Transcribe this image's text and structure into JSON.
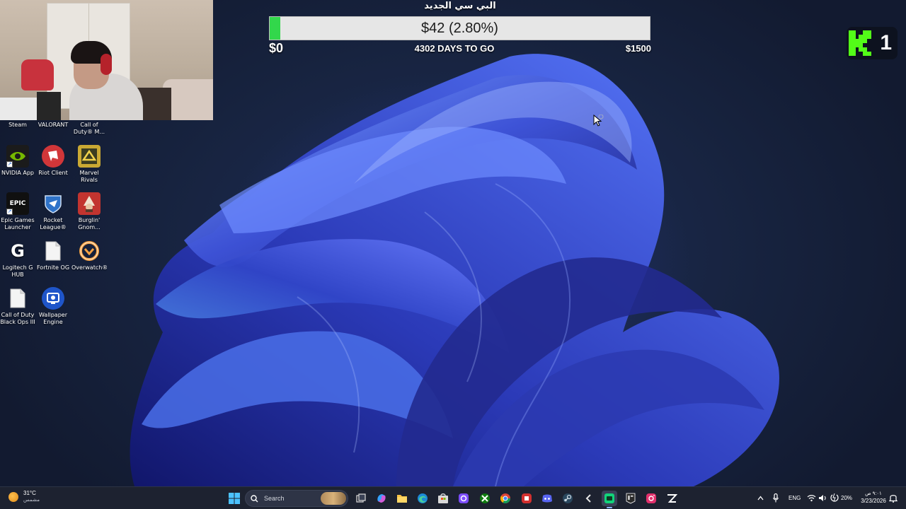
{
  "goal": {
    "title": "البي سي الجديد",
    "amount_text": "$42 (2.80%)",
    "progress_fraction": 0.028,
    "min_label": "$0",
    "days_left_text": "4302 DAYS TO GO",
    "max_label": "$1500",
    "fill_color": "#32d74b"
  },
  "kick": {
    "count": "1",
    "logo_color": "#53fc18"
  },
  "desktop_icons": [
    {
      "label": "Steam"
    },
    {
      "label": "VALORANT"
    },
    {
      "label": "Call of Duty® M..."
    },
    {
      "label": "NVIDIA App",
      "icon": "nvidia-icon"
    },
    {
      "label": "Riot Client",
      "icon": "riot-fist-icon"
    },
    {
      "label": "Marvel Rivals",
      "icon": "marvel-rivals-icon"
    },
    {
      "label": "Epic Games Launcher",
      "icon": "epic-games-icon",
      "icon_text": "EPIC"
    },
    {
      "label": "Rocket League®",
      "icon": "rocket-league-shield-icon"
    },
    {
      "label": "Burglin' Gnom...",
      "icon": "gnome-icon"
    },
    {
      "label": "Logitech G HUB",
      "icon": "logitech-g-icon",
      "icon_text": "G"
    },
    {
      "label": "Fortnite OG",
      "icon": "blank-document-icon"
    },
    {
      "label": "Overwatch®",
      "icon": "overwatch-icon"
    },
    {
      "label": "Call of Duty Black Ops III",
      "icon": "blank-document-icon"
    },
    {
      "label": "Wallpaper Engine",
      "icon": "wallpaper-engine-icon"
    }
  ],
  "taskbar": {
    "weather_temp": "31°C",
    "weather_condition": "مشمس",
    "search_placeholder": "Search",
    "language": "ENG",
    "battery": "20%",
    "time": "٩:٠١ ص",
    "date": "3/23/2026",
    "pinned": [
      "task-view-icon",
      "copilot-icon",
      "file-explorer-icon",
      "edge-icon",
      "microsoft-store-icon",
      "app-purple-icon",
      "xbox-icon",
      "chrome-icon",
      "red-app-icon",
      "discord-icon",
      "steam-icon",
      "back-arrow-app-icon",
      "active-app-icon",
      "epic-games-icon",
      "instagram-icon",
      "capcut-icon"
    ]
  }
}
